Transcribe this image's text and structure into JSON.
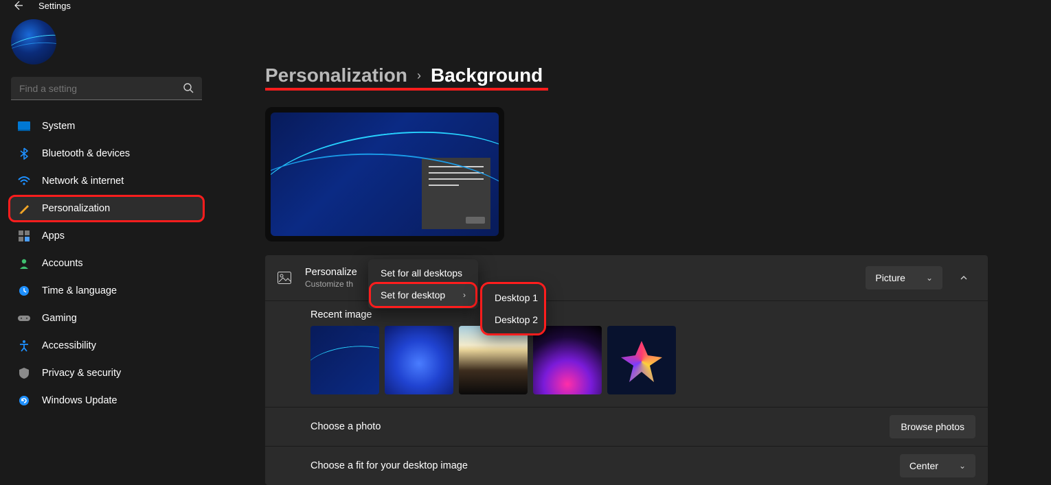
{
  "app": {
    "title": "Settings"
  },
  "search": {
    "placeholder": "Find a setting"
  },
  "sidebar": {
    "items": [
      {
        "label": "System"
      },
      {
        "label": "Bluetooth & devices"
      },
      {
        "label": "Network & internet"
      },
      {
        "label": "Personalization"
      },
      {
        "label": "Apps"
      },
      {
        "label": "Accounts"
      },
      {
        "label": "Time & language"
      },
      {
        "label": "Gaming"
      },
      {
        "label": "Accessibility"
      },
      {
        "label": "Privacy & security"
      },
      {
        "label": "Windows Update"
      }
    ]
  },
  "breadcrumb": {
    "parent": "Personalization",
    "current": "Background"
  },
  "personalize": {
    "title_prefix": "Personalize ",
    "subtitle_prefix": "Customize th",
    "dropdown": "Picture"
  },
  "recent": {
    "label": "Recent image"
  },
  "choose_photo": {
    "label": "Choose a photo",
    "button": "Browse photos"
  },
  "choose_fit": {
    "label": "Choose a fit for your desktop image",
    "dropdown": "Center"
  },
  "context_menu": {
    "items": [
      {
        "label": "Set for all desktops"
      },
      {
        "label": "Set for desktop"
      }
    ],
    "submenu": [
      {
        "label": "Desktop 1"
      },
      {
        "label": "Desktop 2"
      }
    ]
  }
}
